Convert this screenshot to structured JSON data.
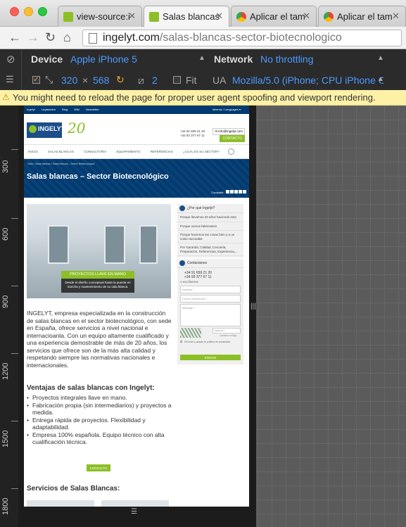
{
  "browser": {
    "tabs": [
      {
        "label": "view-source:i",
        "active": false,
        "favicon_color": "#8cbf26"
      },
      {
        "label": "Salas blancas",
        "active": true,
        "favicon_color": "#8cbf26"
      },
      {
        "label": "Aplicar el tam",
        "active": false,
        "favicon_color": "#4285f4"
      },
      {
        "label": "Aplicar el tam",
        "active": false,
        "favicon_color": "#4285f4"
      }
    ],
    "url_host": "ingelyt.com",
    "url_path": "/salas-blancas-sector-biotecnologico"
  },
  "emulation": {
    "device_label": "Device",
    "device_value": "Apple iPhone 5",
    "network_label": "Network",
    "network_value": "No throttling",
    "width": "320",
    "times": "×",
    "height": "568",
    "scale": "2",
    "fit_label": "Fit",
    "ua_label": "UA",
    "ua_value": "Mozilla/5.0 (iPhone; CPU iPhone O..."
  },
  "warning": "You might need to reload the page for proper user agent spoofing and viewport rendering.",
  "ruler": [
    "300",
    "600",
    "900",
    "1200",
    "1500",
    "1800"
  ],
  "site": {
    "topbar_links": [
      "Ingelyt",
      "Legislación",
      "Blog",
      "Wiki",
      "Newsletter"
    ],
    "topbar_right": "Idiomas / Languages ▾",
    "logo": "INGELYT",
    "anniversary": "20",
    "phones": [
      "+34 91 659 21 20",
      "+34 93 377 67 11"
    ],
    "mail": "info@ingelyt.com",
    "contact_button": "CONTACTO",
    "menu": [
      "INICIO",
      "SALAS BLANCAS",
      "CONSULTORÍA",
      "EQUIPAMIENTO",
      "REFERENCIAS",
      "¿CUÁL ES SU SECTOR?"
    ],
    "breadcrumb": "Inicio / Salas blancas / Salas blancas – Sector Biotecnológico",
    "title": "Salas blancas – Sector Biotecnológico",
    "share_label": "Compartir:",
    "image_ribbon": "PROYECTOS LLAVE EN MANO",
    "image_caption": "Desde el diseño conceptual hasta la puesta en marcha y mantenimiento de su sala blanca.",
    "intro": "INGELYT, empresa especializada en la construcción de salas blancas en el sector biotecnológico, con sede en España, ofrece servicios a nivel nacional e internacioanla. Con un equipo altamente cualificado y una experiencia demostrable de más de 20 años, los servicios que ofrece son de la más alta calidad y respetando siempre las normativas nacionales e internacionales.",
    "advantages_title": "Ventajas de salas blancas con Ingelyt:",
    "advantages": [
      "Proyectos integrales llave en mano.",
      "Fabricación propia (sin intermediarios) y proyectos a medida.",
      "Entrega rápida de proyectos. Flexibilidad y adaptabilidad.",
      "Empresa 100% española. Equipo técnico con alta cualificación técnica."
    ],
    "contact_cta": "CONTACTO",
    "services_title": "Servicios de Salas Blancas:",
    "sidebar": {
      "why_title": "¿Por qué Ingelyt?",
      "why_items": [
        "Porque llevamos 20 años haciendo esto",
        "Porque somos fabricantes",
        "Porque hacemos las cosas bien y a un costo razonable",
        "Por Garantía, Calidad, Cercanía, Preparación, Referencias, Experiencia,..."
      ],
      "contact_title": "Contáctanos",
      "contact_phones": [
        "+34 91 659 21 20",
        "+34 93 377 67 11"
      ],
      "contact_or": "o escríbenos",
      "fields": [
        "Nombre *",
        "Correo electrónico *",
        "Mensaje *"
      ],
      "captcha_label": "Captcha *",
      "captcha_refresh": "Cambiar código",
      "privacy": "He leído y acepto la política de privacidad",
      "send": "ENVIAR"
    }
  }
}
